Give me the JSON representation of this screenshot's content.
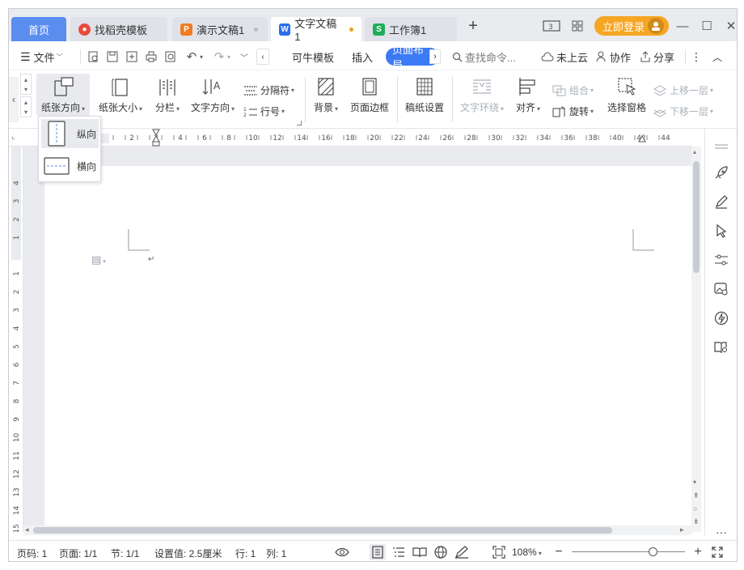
{
  "tabs": {
    "home": "首页",
    "items": [
      {
        "label": "找稻壳模板",
        "icon": "daoke-icon",
        "color": "#e94b3c"
      },
      {
        "label": "演示文稿1",
        "icon": "presentation-icon",
        "color": "#f07b22"
      },
      {
        "label": "文字文稿1",
        "icon": "writer-icon",
        "color": "#2a6ee8"
      },
      {
        "label": "工作簿1",
        "icon": "spreadsheet-icon",
        "color": "#1fae5a"
      }
    ],
    "add": "+",
    "login": "立即登录",
    "badge": "3"
  },
  "menu": {
    "file": "文件",
    "items": [
      "可牛模板",
      "插入",
      "页面布局"
    ],
    "search_placeholder": "查找命令...",
    "cloud": "未上云",
    "collab": "协作",
    "share": "分享"
  },
  "ribbon": {
    "orientation": "纸张方向",
    "size": "纸张大小",
    "columns": "分栏",
    "text_dir": "文字方向",
    "separator": "分隔符",
    "line_num": "行号",
    "background": "背景",
    "page_border": "页面边框",
    "manuscript": "稿纸设置",
    "text_wrap": "文字环绕",
    "align": "对齐",
    "group": "组合",
    "rotate": "旋转",
    "select_pane": "选择窗格",
    "bring_forward": "上移一层",
    "send_backward": "下移一层"
  },
  "dropdown": {
    "portrait": "纵向",
    "landscape": "横向"
  },
  "ruler": {
    "h_labels": [
      "2",
      "2",
      "4",
      "6",
      "8",
      "10",
      "12",
      "14",
      "16",
      "18",
      "20",
      "22",
      "24",
      "26",
      "28",
      "30",
      "32",
      "34",
      "36",
      "38",
      "40",
      "42",
      "44"
    ],
    "v_labels": [
      "4",
      "3",
      "2",
      "1",
      "1",
      "2",
      "3",
      "4",
      "5",
      "6",
      "7",
      "8",
      "9",
      "10",
      "11",
      "12",
      "13",
      "14",
      "15"
    ]
  },
  "status": {
    "page_no": "页码: 1",
    "pages": "页面: 1/1",
    "section": "节: 1/1",
    "setting": "设置值: 2.5厘米",
    "row": "行: 1",
    "col": "列: 1",
    "zoom": "108%",
    "zoom_fraction": 0.72
  },
  "colors": {
    "accent": "#3d7af5",
    "home_tab": "#5b8def",
    "login": "#f5a623"
  }
}
